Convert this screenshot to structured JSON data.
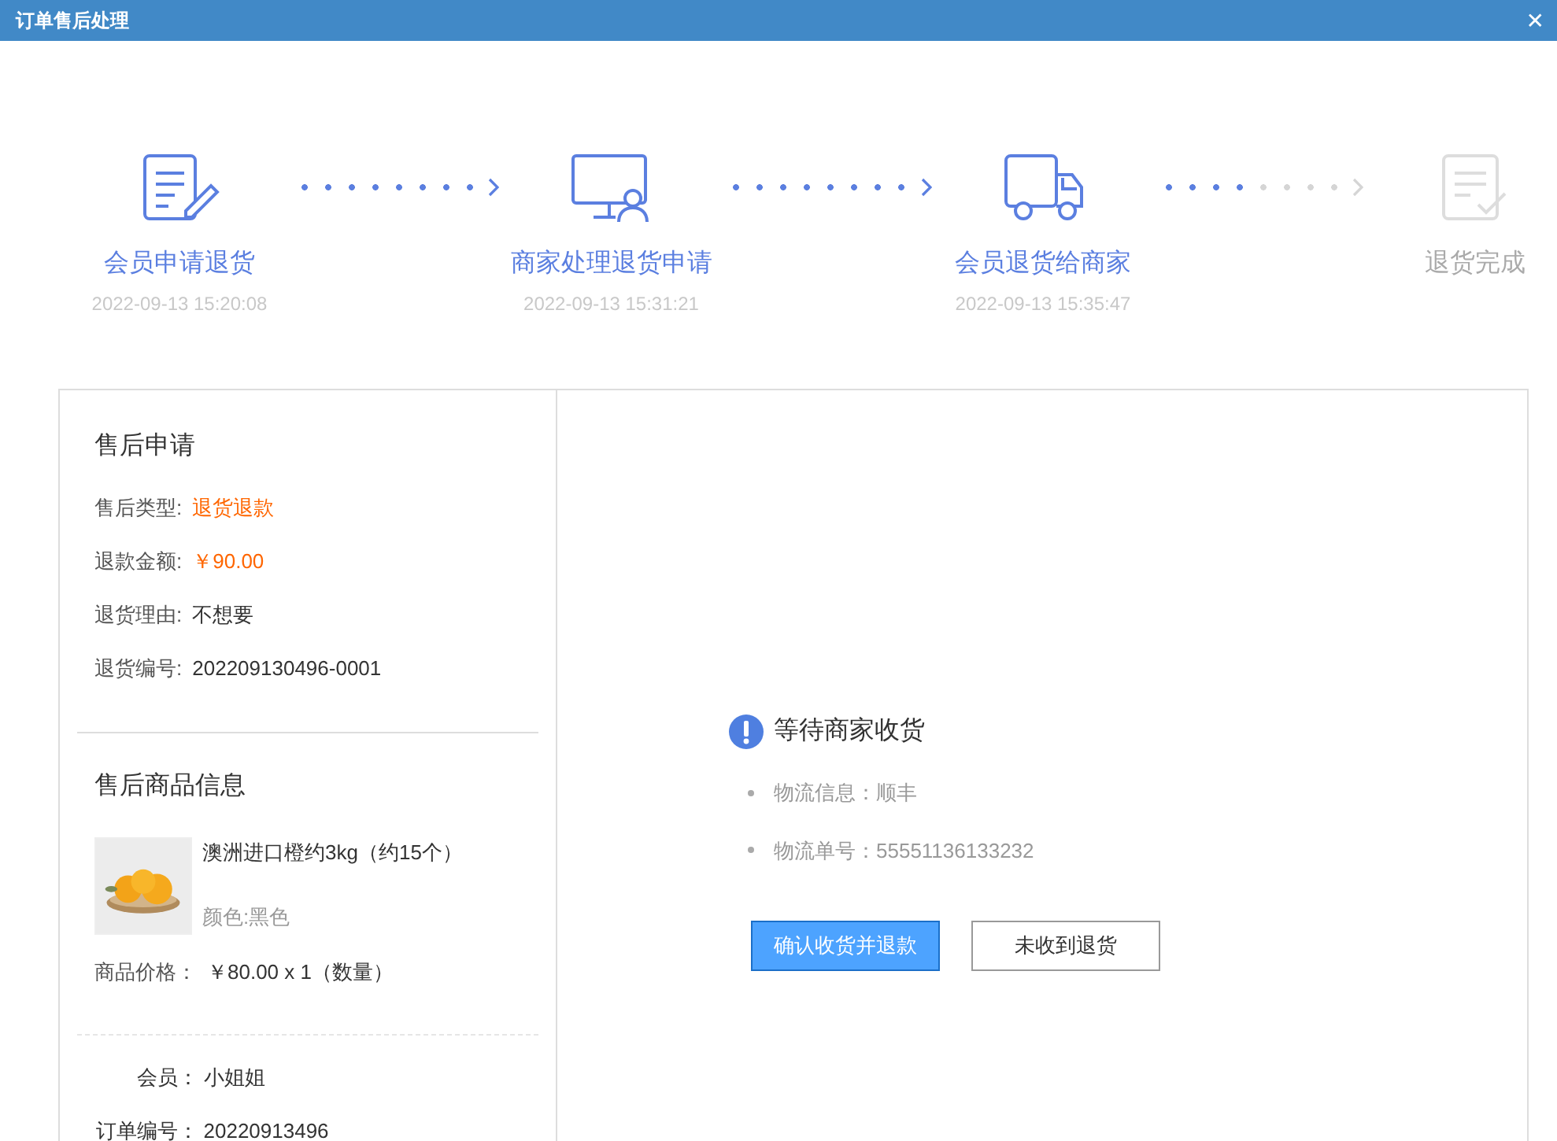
{
  "window": {
    "title": "订单售后处理",
    "close": "✕"
  },
  "steps": [
    {
      "kind": "form",
      "label": "会员申请退货",
      "time": "2022-09-13 15:20:08",
      "done": true
    },
    {
      "kind": "monitor",
      "label": "商家处理退货申请",
      "time": "2022-09-13 15:31:21",
      "done": true
    },
    {
      "kind": "truck",
      "label": "会员退货给商家",
      "time": "2022-09-13 15:35:47",
      "done": true
    },
    {
      "kind": "checked-doc",
      "label": "退货完成",
      "done": false
    }
  ],
  "connectors": [
    {
      "level": 1
    },
    {
      "level": 1
    },
    {
      "level": 0.5
    }
  ],
  "aftersale_request": {
    "title": "售后申请",
    "fields": [
      {
        "label": "售后类型:",
        "value": "退货退款",
        "emphasis": true
      },
      {
        "label": "退款金额:",
        "value": "￥90.00",
        "emphasis": true
      },
      {
        "label": "退货理由:",
        "value": "不想要",
        "emphasis": false
      },
      {
        "label": "退货编号:",
        "value": "202209130496-0001",
        "emphasis": false
      }
    ]
  },
  "product_info": {
    "title": "售后商品信息",
    "product": {
      "kind": "picture",
      "name": "澳洲进口橙约3kg（约15个）",
      "variant": "颜色:黑色"
    },
    "price_label": "商品价格：",
    "price": "￥80.00 x 1（数量）",
    "order_fields": [
      {
        "label": "会员：",
        "value": "小姐姐"
      },
      {
        "label": "订单编号：",
        "value": "20220913496"
      }
    ]
  },
  "status": {
    "title": "等待商家收货",
    "items": [
      "物流信息：顺丰",
      "物流单号：55551136133232"
    ],
    "buttons": [
      {
        "label": "确认收货并退款",
        "primary": true
      },
      {
        "label": "未收到退货",
        "primary": false
      }
    ]
  }
}
